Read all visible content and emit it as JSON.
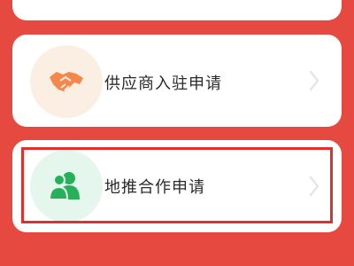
{
  "menu": {
    "items": [
      {
        "label": "供应商入驻申请",
        "icon": "handshake-icon",
        "icon_color": "#f5874a",
        "icon_bg": "#fbeee3"
      },
      {
        "label": "地推合作申请",
        "icon": "users-icon",
        "icon_color": "#27b05a",
        "icon_bg": "#e5f6ec"
      }
    ]
  },
  "colors": {
    "background": "#e5493f",
    "card": "#ffffff",
    "highlight_border": "#e02f2f",
    "chevron": "#d8d8d8"
  }
}
